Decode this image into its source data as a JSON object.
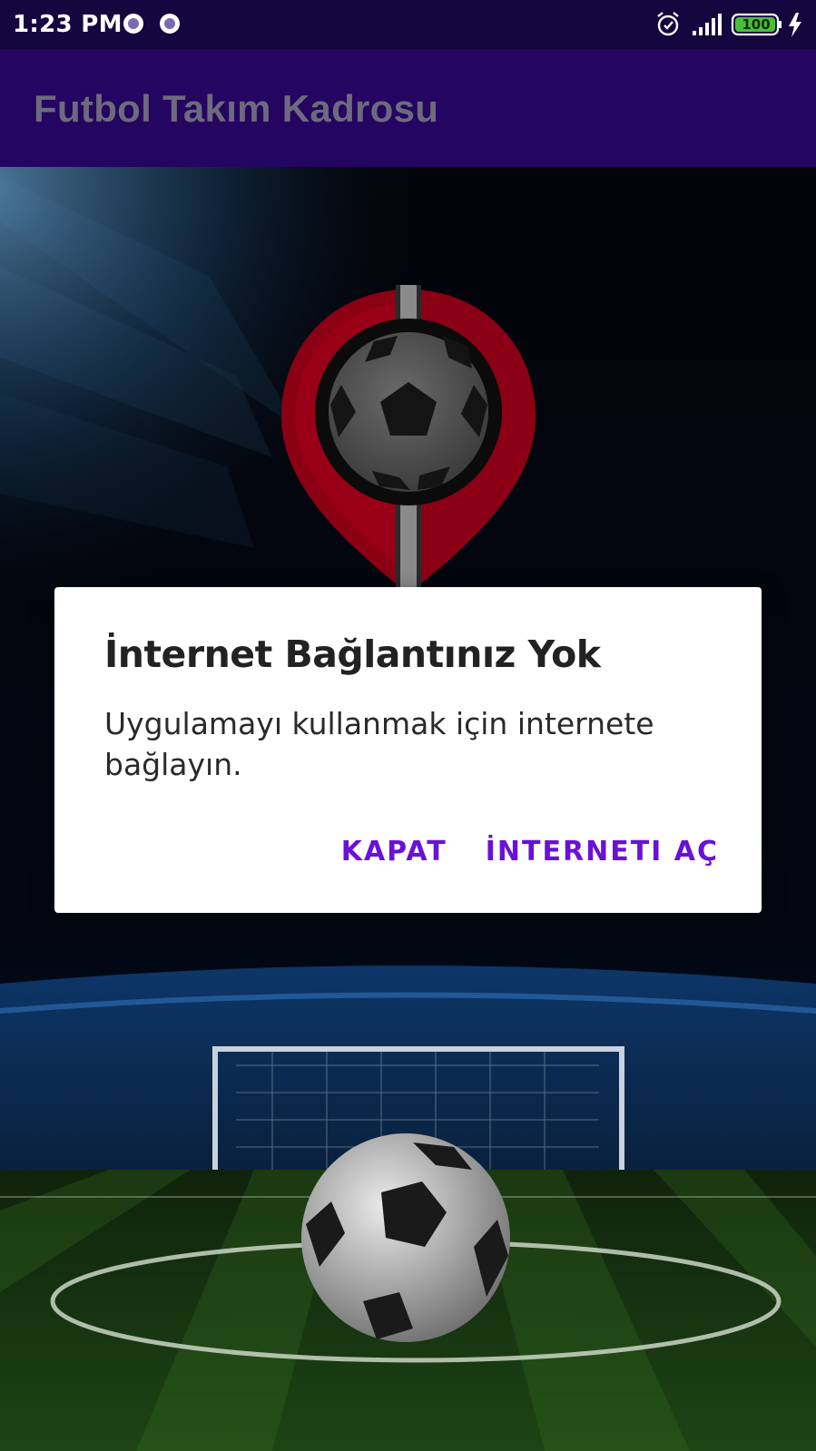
{
  "status_bar": {
    "time": "1:23 PM",
    "battery": "100",
    "notification_icons": [
      "app-notification-icon",
      "app-notification-icon"
    ],
    "icons": [
      "alarm-icon",
      "signal-icon",
      "battery-icon",
      "charging-icon"
    ]
  },
  "app_bar": {
    "title": "Futbol Takım Kadrosu"
  },
  "dialog": {
    "title": "İnternet Bağlantınız Yok",
    "message": "Uygulamayı kullanmak için internete bağlayın.",
    "buttons": {
      "negative": "KAPAT",
      "positive": "İNTERNETI AÇ"
    }
  },
  "colors": {
    "status_bar": "#14063e",
    "app_bar": "#240561",
    "accent": "#6a10d8",
    "logo_red": "#8b0014"
  }
}
